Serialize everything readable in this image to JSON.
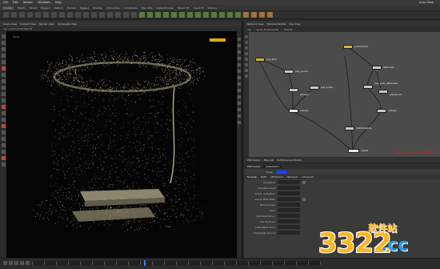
{
  "menubar": {
    "items": [
      "File",
      "Edit",
      "Render",
      "Windows",
      "Help"
    ],
    "desktop": "Auto Desk"
  },
  "shelf": {
    "tabs": [
      "Create",
      "Modify",
      "Model",
      "Polygon",
      "Deform",
      "Texture",
      "Rigging",
      "Muscles",
      "Characters",
      "Constraints",
      "Hair Utils",
      "Guide Process",
      "Terrain FX",
      "Cloud FX",
      "Volume"
    ]
  },
  "viewer": {
    "tabs": [
      "Scene View",
      "Context View",
      "Render View",
      "Composite View"
    ],
    "path": "obj  >  grain_flow/dopnet",
    "viewport_label": "Persp",
    "camera_label": "No cam"
  },
  "network": {
    "tabs": [
      "Network View",
      "Material Palette",
      "Tree View"
    ],
    "path": [
      "obj",
      "grain_flow/dopnet",
      "dopnet"
    ],
    "watermark": "Non-Commercial Edition",
    "nodes": [
      {
        "label": "pop_fluid"
      },
      {
        "label": "grainsolver1"
      },
      {
        "label": "pop_source"
      },
      {
        "label": "pop_solver"
      },
      {
        "label": "gravity1"
      },
      {
        "label": "merge1"
      },
      {
        "label": "staticobj1"
      },
      {
        "label": "pop_grain_attributes"
      },
      {
        "label": "popsolver1"
      },
      {
        "label": "merge2"
      },
      {
        "label": "distributedobj"
      },
      {
        "label": "output"
      }
    ]
  },
  "params": {
    "tabs": [
      "POP Solver",
      "Take List",
      "Performance Monitor"
    ],
    "node_type": "POP Solver",
    "node_name": "popsolver1",
    "code_label": "Code",
    "inner_tabs": [
      "Sources",
      "Birth",
      "Attribution",
      "Behavior",
      "Advanced"
    ],
    "rows": [
      {
        "label": "Activation"
      },
      {
        "label": "Impulse Count"
      },
      {
        "label": "Const. Activation"
      },
      {
        "label": "Const. Birth Rate"
      },
      {
        "label": "Birth Groups"
      },
      {
        "label": "Seed"
      },
      {
        "label": "Life Expectancy"
      },
      {
        "label": "Life Variance"
      },
      {
        "label": "Initial Birth Time"
      },
      {
        "label": "Interpolate Source"
      }
    ]
  },
  "timeline": {
    "frame": "1"
  },
  "badge": {
    "number": "3322",
    "site": "软件站",
    "domain": ".cc"
  }
}
